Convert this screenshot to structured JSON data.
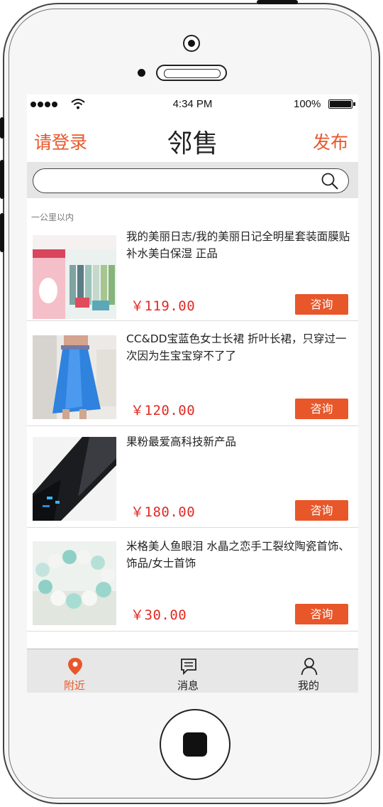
{
  "status_bar": {
    "time": "4:34 PM",
    "battery": "100%"
  },
  "nav": {
    "left_label": "请登录",
    "title": "邻售",
    "right_label": "发布"
  },
  "search": {
    "placeholder": ""
  },
  "section_label": "一公里以内",
  "products": [
    {
      "title": "我的美丽日志/我的美丽日记全明星套装面膜贴补水美白保湿 正品",
      "price": "￥119.00",
      "action": "咨询",
      "image": "face-mask-box-image"
    },
    {
      "title": "CC&DD宝蓝色女士长裙 折叶长裙，只穿过一次因为生宝宝穿不了了",
      "price": "￥120.00",
      "action": "咨询",
      "image": "blue-skirt-image"
    },
    {
      "title": "果粉最爱高科技新产品",
      "price": "￥180.00",
      "action": "咨询",
      "image": "tech-gadget-image"
    },
    {
      "title": "米格美人鱼眼泪 水晶之恋手工裂纹陶瓷首饰、饰品/女士首饰",
      "price": "￥30.00",
      "action": "咨询",
      "image": "bead-bracelet-image"
    }
  ],
  "tabs": [
    {
      "label": "附近",
      "icon": "location-pin-icon",
      "active": true
    },
    {
      "label": "消息",
      "icon": "message-icon",
      "active": false
    },
    {
      "label": "我的",
      "icon": "user-icon",
      "active": false
    }
  ],
  "colors": {
    "accent": "#e8572a",
    "price": "#e02a22",
    "tab_bar": "#e7e7e7"
  }
}
